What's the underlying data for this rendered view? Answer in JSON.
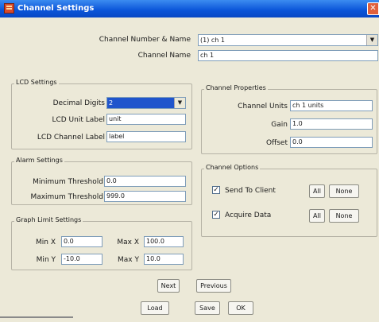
{
  "window": {
    "title": "Channel Settings",
    "close_glyph": "✕",
    "close_icon": "close-icon",
    "app_icon": "settings-window-icon"
  },
  "channel_number_name": {
    "label": "Channel Number & Name",
    "value": "(1) ch 1",
    "arrow": "▼"
  },
  "channel_name": {
    "label": "Channel Name",
    "value": "ch 1"
  },
  "lcd_settings": {
    "title": "LCD Settings",
    "decimal_digits": {
      "label": "Decimal Digits",
      "value": "2",
      "arrow": "▼"
    },
    "unit_label": {
      "label": "LCD Unit Label",
      "value": "unit"
    },
    "channel_label": {
      "label": "LCD Channel Label",
      "value": "label"
    }
  },
  "alarm_settings": {
    "title": "Alarm Settings",
    "min": {
      "label": "Minimum Threshold",
      "value": "0.0"
    },
    "max": {
      "label": "Maximum Threshold",
      "value": "999.0"
    }
  },
  "graph_limit": {
    "title": "Graph Limit Settings",
    "min_x": {
      "label": "Min X",
      "value": "0.0"
    },
    "max_x": {
      "label": "Max X",
      "value": "100.0"
    },
    "min_y": {
      "label": "Min Y",
      "value": "-10.0"
    },
    "max_y": {
      "label": "Max Y",
      "value": "10.0"
    }
  },
  "channel_properties": {
    "title": "Channel Properties",
    "units": {
      "label": "Channel Units",
      "value": "ch 1 units"
    },
    "gain": {
      "label": "Gain",
      "value": "1.0"
    },
    "offset": {
      "label": "Offset",
      "value": "0.0"
    }
  },
  "channel_options": {
    "title": "Channel Options",
    "send_to_client": {
      "label": "Send To Client",
      "checked": true,
      "all": "All",
      "none": "None"
    },
    "acquire_data": {
      "label": "Acquire Data",
      "checked": true,
      "all": "All",
      "none": "None"
    }
  },
  "check_glyph": "✓",
  "buttons": {
    "next": "Next",
    "previous": "Previous",
    "load": "Load",
    "save": "Save",
    "ok": "OK"
  },
  "colors": {
    "title_bar": "#0a54d8",
    "window_bg": "#ece9d8",
    "selection": "#2055cc",
    "field_border": "#7f9db9"
  }
}
